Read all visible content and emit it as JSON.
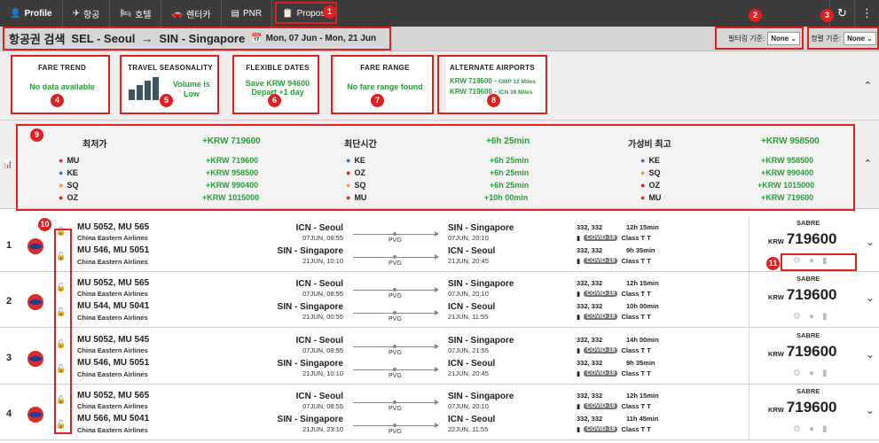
{
  "topbar": {
    "items": [
      {
        "icon": "person-icon",
        "label": "Profile"
      },
      {
        "icon": "plane-icon",
        "label": "항공"
      },
      {
        "icon": "bed-icon",
        "label": "호텔"
      },
      {
        "icon": "car-icon",
        "label": "렌터카"
      },
      {
        "icon": "card-icon",
        "label": "PNR"
      },
      {
        "icon": "clipboard-icon",
        "label": "Proposal"
      }
    ],
    "right_icons": [
      "history-icon",
      "more-icon"
    ]
  },
  "header": {
    "title": "항공권 검색",
    "from": "SEL - Seoul",
    "arrow": "→",
    "to": "SIN - Singapore",
    "dates": "Mon, 07 Jun - Mon, 21 Jun",
    "filter_label": "필터링 기준:",
    "filter_value": "None",
    "sort_label": "정렬 기준:",
    "sort_value": "None"
  },
  "cards": {
    "fare_trend": {
      "title": "FARE TREND",
      "text": "No data available"
    },
    "seasonality": {
      "title": "TRAVEL SEASONALITY",
      "text1": "Volume is",
      "text2": "Low"
    },
    "flexible": {
      "title": "FLEXIBLE DATES",
      "text1": "Save KRW 94600",
      "text2": "Depart +1 day"
    },
    "fare_range": {
      "title": "FARE RANGE",
      "text": "No fare range found"
    },
    "alternate": {
      "title": "ALTERNATE AIRPORTS",
      "line1_price": "KRW 719600",
      "line1_airport": "GMP 12 Miles",
      "line2_price": "KRW 719600",
      "line2_airport": "ICN 36 Miles"
    }
  },
  "comparison": {
    "cheapest": {
      "label": "최저가",
      "value": "+KRW 719600"
    },
    "shortest": {
      "label": "최단시간",
      "value": "+6h 25min"
    },
    "best": {
      "label": "가성비 최고",
      "value": "+KRW 958500"
    },
    "col1": [
      {
        "code": "MU",
        "value": "+KRW 719600"
      },
      {
        "code": "KE",
        "value": "+KRW 958500"
      },
      {
        "code": "SQ",
        "value": "+KRW 990400"
      },
      {
        "code": "OZ",
        "value": "+KRW 1015000"
      }
    ],
    "col2": [
      {
        "code": "KE",
        "value": "+6h 25min"
      },
      {
        "code": "OZ",
        "value": "+6h 25min"
      },
      {
        "code": "SQ",
        "value": "+6h 25min"
      },
      {
        "code": "MU",
        "value": "+10h 00min"
      }
    ],
    "col3": [
      {
        "code": "KE",
        "value": "+KRW 958500"
      },
      {
        "code": "SQ",
        "value": "+KRW 990400"
      },
      {
        "code": "OZ",
        "value": "+KRW 1015000"
      },
      {
        "code": "MU",
        "value": "+KRW 719600"
      }
    ]
  },
  "results": [
    {
      "n": "1",
      "out_flight": "MU 5052, MU 565",
      "out_airline": "China Eastern Airlines",
      "in_flight": "MU 546, MU 5051",
      "in_airline": "China Eastern Airlines",
      "out_dep": "ICN - Seoul",
      "out_dep_dt": "07JUN, 08:55",
      "out_arr": "SIN - Singapore",
      "out_arr_dt": "07JUN, 20:10",
      "in_dep": "SIN - Singapore",
      "in_dep_dt": "21JUN, 10:10",
      "in_arr": "ICN - Seoul",
      "in_arr_dt": "21JUN, 20:45",
      "via1": "PVG",
      "via2": "PVG",
      "eq1": "332, 332",
      "dur1": "12h 15min",
      "eq2": "332, 332",
      "dur2": "9h 35min",
      "covid": "COVID-19",
      "cls": "Class T T",
      "source": "SABRE",
      "cur": "KRW",
      "price": "719600"
    },
    {
      "n": "2",
      "out_flight": "MU 5052, MU 565",
      "out_airline": "China Eastern Airlines",
      "in_flight": "MU 544, MU 5041",
      "in_airline": "China Eastern Airlines",
      "out_dep": "ICN - Seoul",
      "out_dep_dt": "07JUN, 08:55",
      "out_arr": "SIN - Singapore",
      "out_arr_dt": "07JUN, 20:10",
      "in_dep": "SIN - Singapore",
      "in_dep_dt": "21JUN, 00:55",
      "in_arr": "ICN - Seoul",
      "in_arr_dt": "21JUN, 11:55",
      "via1": "PVG",
      "via2": "PVG",
      "eq1": "332, 332",
      "dur1": "12h 15min",
      "eq2": "332, 332",
      "dur2": "10h 00min",
      "covid": "COVID-19",
      "cls": "Class T T",
      "source": "SABRE",
      "cur": "KRW",
      "price": "719600"
    },
    {
      "n": "3",
      "out_flight": "MU 5052, MU 545",
      "out_airline": "China Eastern Airlines",
      "in_flight": "MU 546, MU 5051",
      "in_airline": "China Eastern Airlines",
      "out_dep": "ICN - Seoul",
      "out_dep_dt": "07JUN, 08:55",
      "out_arr": "SIN - Singapore",
      "out_arr_dt": "07JUN, 21:55",
      "in_dep": "SIN - Singapore",
      "in_dep_dt": "21JUN, 10:10",
      "in_arr": "ICN - Seoul",
      "in_arr_dt": "21JUN, 20:45",
      "via1": "PVG",
      "via2": "PVG",
      "eq1": "332, 332",
      "dur1": "14h 00min",
      "eq2": "332, 332",
      "dur2": "9h 35min",
      "covid": "COVID-19",
      "cls": "Class T T",
      "source": "SABRE",
      "cur": "KRW",
      "price": "719600"
    },
    {
      "n": "4",
      "out_flight": "MU 5052, MU 565",
      "out_airline": "China Eastern Airlines",
      "in_flight": "MU 566, MU 5041",
      "in_airline": "China Eastern Airlines",
      "out_dep": "ICN - Seoul",
      "out_dep_dt": "07JUN, 08:55",
      "out_arr": "SIN - Singapore",
      "out_arr_dt": "07JUN, 20:10",
      "in_dep": "SIN - Singapore",
      "in_dep_dt": "21JUN, 23:10",
      "in_arr": "ICN - Seoul",
      "in_arr_dt": "22JUN, 11:55",
      "via1": "PVG",
      "via2": "PVG",
      "eq1": "332, 332",
      "dur1": "12h 15min",
      "eq2": "332, 332",
      "dur2": "11h 45min",
      "covid": "COVID-19",
      "cls": "Class T T",
      "source": "SABRE",
      "cur": "KRW",
      "price": "719600"
    }
  ],
  "annotations": [
    "1",
    "2",
    "3",
    "4",
    "5",
    "6",
    "7",
    "8",
    "9",
    "10",
    "11"
  ],
  "colors": {
    "accent_green": "#2a9d3a",
    "annotation_red": "#e02020",
    "topbar": "#3c3c3c"
  }
}
